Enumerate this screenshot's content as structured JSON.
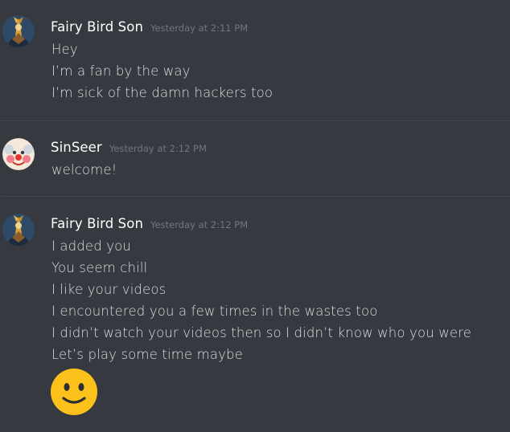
{
  "messages": [
    {
      "username": "Fairy Bird Son",
      "timestamp": "Yesterday at 2:11 PM",
      "lines": [
        "Hey",
        "I’m a fan by the way",
        "I’m sick of the damn hackers too"
      ]
    },
    {
      "username": "SinSeer",
      "timestamp": "Yesterday at 2:12 PM",
      "lines": [
        "welcome!"
      ]
    },
    {
      "username": "Fairy Bird Son",
      "timestamp": "Yesterday at 2:12 PM",
      "lines": [
        "I added you",
        "You seem chill",
        "I like your videos",
        "I encountered you a few times in the wastes too",
        "I didn’t watch your videos then so I didn’t know who you were",
        "Let’s play some time maybe"
      ],
      "emoji": "slightly-smiling-face"
    }
  ],
  "colors": {
    "background": "#36393f",
    "username": "#ffffff",
    "timestamp": "#72767d",
    "text": "#dcddde",
    "emoji": "#fcc21b"
  }
}
